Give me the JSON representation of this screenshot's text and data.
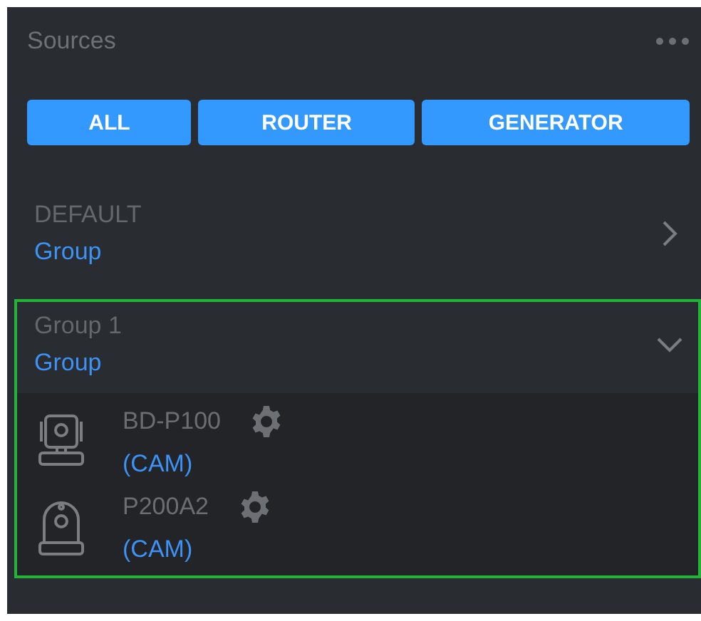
{
  "header": {
    "title": "Sources"
  },
  "filters": [
    {
      "label": "ALL"
    },
    {
      "label": "ROUTER"
    },
    {
      "label": "GENERATOR"
    }
  ],
  "groups": [
    {
      "name": "DEFAULT",
      "type": "Group",
      "expanded": false,
      "selected": false
    },
    {
      "name": "Group 1",
      "type": "Group",
      "expanded": true,
      "selected": true,
      "devices": [
        {
          "name": "BD-P100",
          "type": "(CAM)",
          "kind": "ptz"
        },
        {
          "name": "P200A2",
          "type": "(CAM)",
          "kind": "dome"
        }
      ]
    }
  ]
}
